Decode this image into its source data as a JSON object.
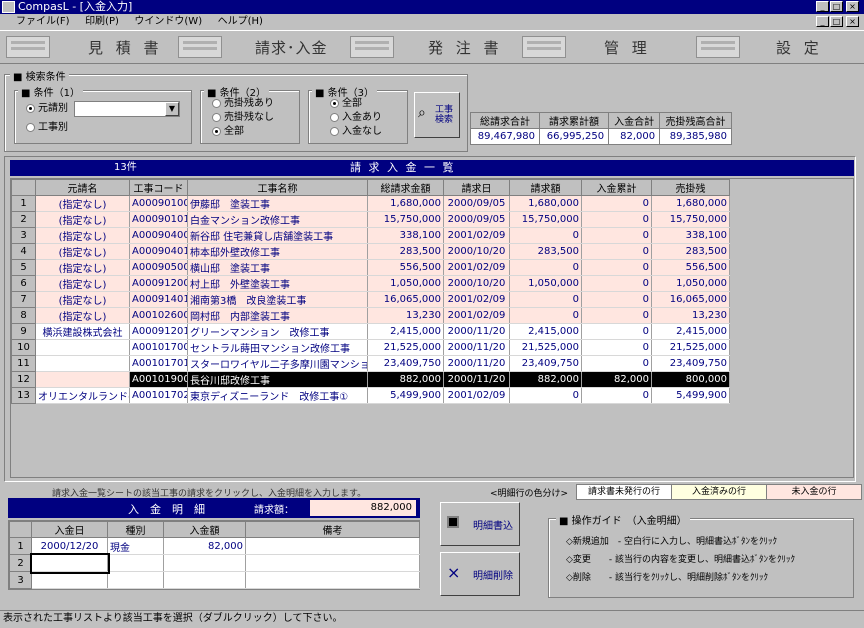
{
  "window": {
    "title": "CompasL - [入金入力]"
  },
  "menu": [
    "ファイル(F)",
    "印刷(P)",
    "ウインドウ(W)",
    "ヘルプ(H)"
  ],
  "nav": [
    "見 積 書",
    "請求･入金",
    "発 注 書",
    "管 理",
    "設 定"
  ],
  "search": {
    "title": "検索条件",
    "cond1": {
      "label": "条件（1）",
      "opt1": "元請別",
      "opt2": "工事別"
    },
    "cond2": {
      "label": "条件（2）",
      "opts": [
        "売掛残あり",
        "売掛残なし",
        "全部"
      ]
    },
    "cond3": {
      "label": "条件（3）",
      "opts": [
        "全部",
        "入金あり",
        "入金なし"
      ]
    },
    "button": "工事検索"
  },
  "summary": {
    "headers": [
      "総請求合計",
      "請求累計額",
      "入金合計",
      "売掛残高合計"
    ],
    "values": [
      "89,467,980",
      "66,995,250",
      "82,000",
      "89,385,980"
    ]
  },
  "list": {
    "count": "13件",
    "title": "請 求 入 金 一 覧",
    "columns": [
      "元請名",
      "工事コード",
      "工事名称",
      "総請求金額",
      "請求日",
      "請求額",
      "入金累計",
      "売掛残"
    ],
    "rows": [
      {
        "n": "1",
        "client": "(指定なし)",
        "code": "A00090100",
        "name": "伊藤邸　塗装工事",
        "total": "1,680,000",
        "date": "2000/09/05",
        "billed": "1,680,000",
        "paid": "0",
        "balance": "1,680,000"
      },
      {
        "n": "2",
        "client": "(指定なし)",
        "code": "A00090101",
        "name": "白金マンション改修工事",
        "total": "15,750,000",
        "date": "2000/09/05",
        "billed": "15,750,000",
        "paid": "0",
        "balance": "15,750,000"
      },
      {
        "n": "3",
        "client": "(指定なし)",
        "code": "A00090400",
        "name": "新谷邸 住宅兼貸し店舗塗装工事",
        "total": "338,100",
        "date": "2001/02/09",
        "billed": "0",
        "paid": "0",
        "balance": "338,100"
      },
      {
        "n": "4",
        "client": "(指定なし)",
        "code": "A00090401",
        "name": "柿本邸外壁改修工事",
        "total": "283,500",
        "date": "2000/10/20",
        "billed": "283,500",
        "paid": "0",
        "balance": "283,500"
      },
      {
        "n": "5",
        "client": "(指定なし)",
        "code": "A00090500",
        "name": "横山邸　塗装工事",
        "total": "556,500",
        "date": "2001/02/09",
        "billed": "0",
        "paid": "0",
        "balance": "556,500"
      },
      {
        "n": "6",
        "client": "(指定なし)",
        "code": "A00091200",
        "name": "村上邸　外壁塗装工事",
        "total": "1,050,000",
        "date": "2000/10/20",
        "billed": "1,050,000",
        "paid": "0",
        "balance": "1,050,000"
      },
      {
        "n": "7",
        "client": "(指定なし)",
        "code": "A00091401",
        "name": "湘南第3橋　改良塗装工事",
        "total": "16,065,000",
        "date": "2001/02/09",
        "billed": "0",
        "paid": "0",
        "balance": "16,065,000"
      },
      {
        "n": "8",
        "client": "(指定なし)",
        "code": "A00102600",
        "name": "岡村邸　内部塗装工事",
        "total": "13,230",
        "date": "2001/02/09",
        "billed": "0",
        "paid": "0",
        "balance": "13,230"
      },
      {
        "n": "9",
        "client": "横浜建設株式会社",
        "code": "A00091201",
        "name": "グリーンマンション　改修工事",
        "total": "2,415,000",
        "date": "2000/11/20",
        "billed": "2,415,000",
        "paid": "0",
        "balance": "2,415,000"
      },
      {
        "n": "10",
        "client": "",
        "code": "A00101700",
        "name": "セントラル蒔田マンション改修工事",
        "total": "21,525,000",
        "date": "2000/11/20",
        "billed": "21,525,000",
        "paid": "0",
        "balance": "21,525,000"
      },
      {
        "n": "11",
        "client": "",
        "code": "A00101701",
        "name": "スターロワイヤル二子多摩川園マンション改",
        "total": "23,409,750",
        "date": "2000/11/20",
        "billed": "23,409,750",
        "paid": "0",
        "balance": "23,409,750"
      },
      {
        "n": "12",
        "client": "",
        "code": "A00101900",
        "name": "長谷川邸改修工事",
        "total": "882,000",
        "date": "2000/11/20",
        "billed": "882,000",
        "paid": "82,000",
        "balance": "800,000"
      },
      {
        "n": "13",
        "client": "オリエンタルランド(株)",
        "code": "A00101702",
        "name": "東京ディズニーランド　改修工事①",
        "total": "5,499,900",
        "date": "2001/02/09",
        "billed": "0",
        "paid": "0",
        "balance": "5,499,900"
      }
    ]
  },
  "instruction": "請求入金一覧シートの該当工事の請求をクリックし、入金明細を入力します。",
  "detail": {
    "title": "入　金　明　細",
    "billed_label": "請求額：",
    "billed_value": "882,000",
    "columns": [
      "入金日",
      "種別",
      "入金額",
      "備考"
    ],
    "rows": [
      {
        "n": "1",
        "date": "2000/12/20",
        "type": "現金",
        "amount": "82,000",
        "note": ""
      },
      {
        "n": "2",
        "date": "",
        "type": "",
        "amount": "",
        "note": ""
      },
      {
        "n": "3",
        "date": "",
        "type": "",
        "amount": "",
        "note": ""
      }
    ]
  },
  "buttons": {
    "write": "明細書込",
    "delete": "明細削除"
  },
  "legend": {
    "title": "<明細行の色分け>",
    "items": [
      "請求書未発行の行",
      "入金済みの行",
      "未入金の行"
    ]
  },
  "guide": {
    "title": "操作ガイド　（入金明細）",
    "lines": [
      "◇新規追加　- 空白行に入力し、明細書込ﾎﾞﾀﾝをｸﾘｯｸ",
      "◇変更　　- 該当行の内容を変更し、明細書込ﾎﾞﾀﾝをｸﾘｯｸ",
      "◇削除　　- 該当行をｸﾘｯｸし、明細削除ﾎﾞﾀﾝをｸﾘｯｸ"
    ]
  },
  "status": "表示された工事リストより該当工事を選択（ダブルクリック）して下さい。"
}
